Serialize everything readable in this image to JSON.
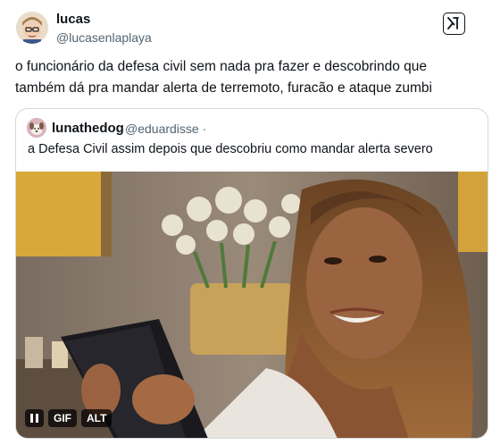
{
  "tweet": {
    "author_name": "lucas",
    "author_handle": "@lucasenlaplaya",
    "text": "o funcionário da defesa civil sem nada pra fazer e descobrindo que também dá pra mandar alerta de terremoto, furacão e ataque zumbi",
    "avatar_icon": "cartoon-avatar-icon",
    "x_logo_icon": "x-logo-icon"
  },
  "quote": {
    "author_name": "lunathedog",
    "author_handle": "@eduardisse ·",
    "text": "a Defesa Civil assim depois que descobriu como mandar alerta severo",
    "avatar_icon": "dog-avatar-icon",
    "media": {
      "type": "gif",
      "description_icon": "woman-looking-at-phone-gif",
      "controls": {
        "pause_icon": "pause-icon",
        "gif_label": "GIF",
        "alt_label": "ALT"
      }
    }
  },
  "colors": {
    "text_primary": "#0f1419",
    "text_secondary": "#536471",
    "border": "#cfd9de"
  }
}
